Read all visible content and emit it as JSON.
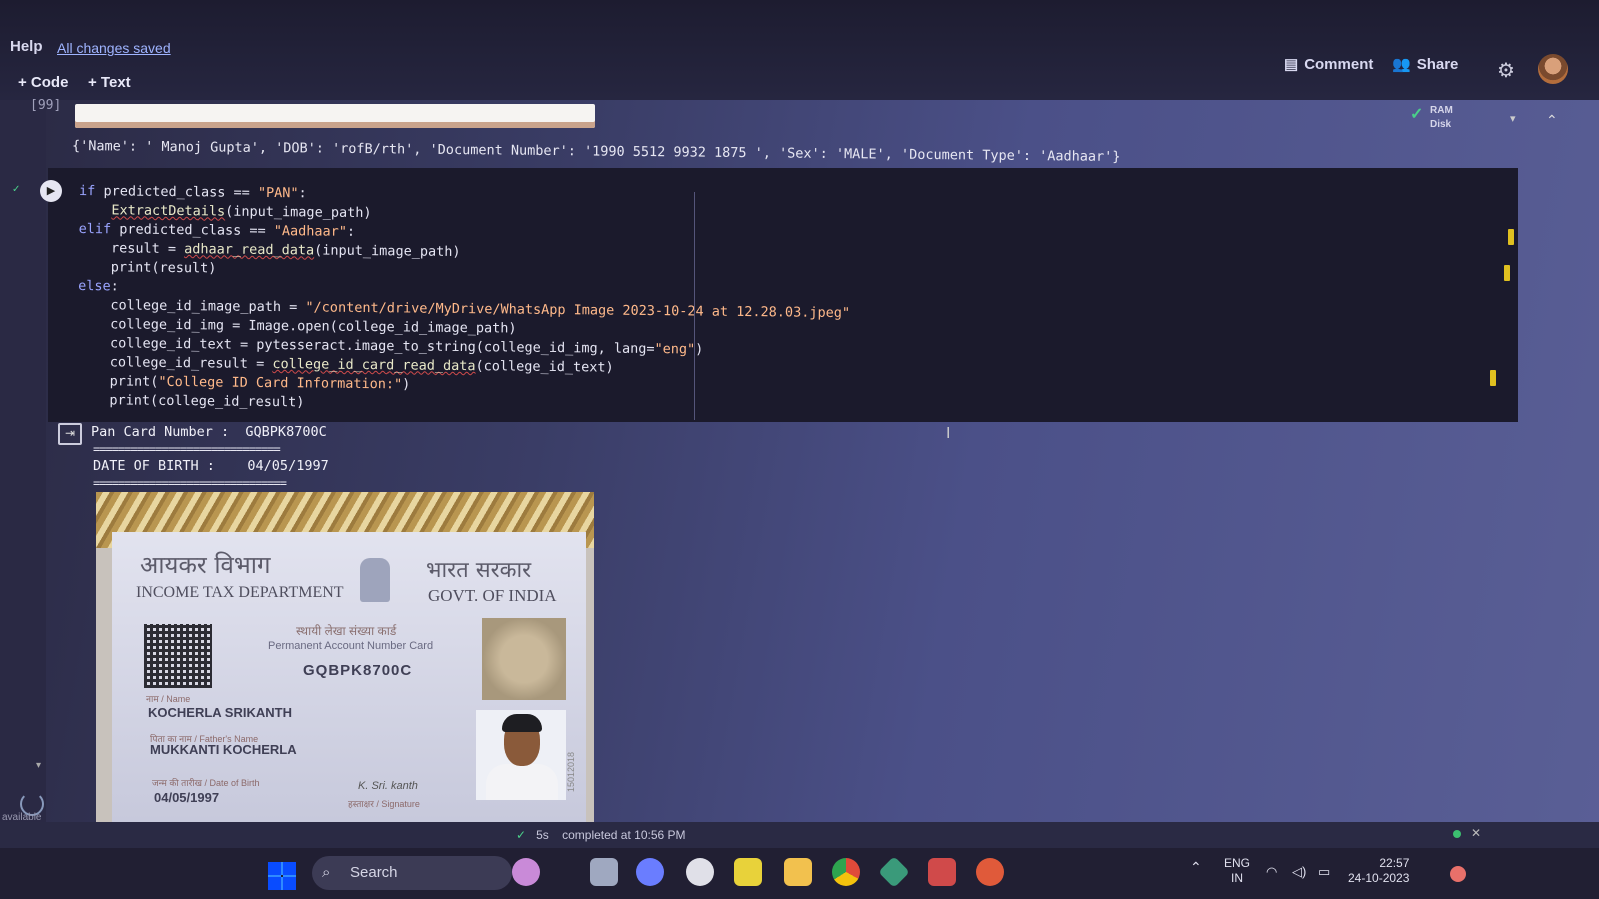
{
  "menu": {
    "help": "Help",
    "saved": "All changes saved"
  },
  "toolbar": {
    "code": "+ Code",
    "text": "+ Text"
  },
  "actions": {
    "comment": "Comment",
    "share": "Share"
  },
  "resources": {
    "ram": "RAM",
    "disk": "Disk"
  },
  "prev_cell": {
    "exec_count": "[99]",
    "output": "{'Name': ' Manoj Gupta', 'DOB': 'rofB/rth', 'Document Number': '1990 5512 9932 1875 ', 'Sex': 'MALE', 'Document Type': 'Aadhaar'}"
  },
  "code_lines": [
    "if predicted_class == \"PAN\":",
    "    ExtractDetails(input_image_path)",
    "elif predicted_class == \"Aadhaar\":",
    "    result = adhaar_read_data(input_image_path)",
    "    print(result)",
    "else:",
    "    college_id_image_path = \"/content/drive/MyDrive/WhatsApp Image 2023-10-24 at 12.28.03.jpeg\"",
    "    college_id_img = Image.open(college_id_image_path)",
    "    college_id_text = pytesseract.image_to_string(college_id_img, lang=\"eng\")",
    "    college_id_result = college_id_card_read_data(college_id_text)",
    "    print(\"College ID Card Information:\")",
    "    print(college_id_result)"
  ],
  "output": {
    "pan_line": "Pan Card Number :  GQBPK8700C",
    "sep1": "==============================",
    "dob_line": "DATE OF BIRTH :    04/05/1997",
    "sep2": "==============================="
  },
  "pan_card": {
    "dept_hindi": "आयकर विभाग",
    "dept_english": "INCOME TAX DEPARTMENT",
    "govt_hindi": "भारत सरकार",
    "govt_english": "GOVT. OF INDIA",
    "pan_hindi": "स्थायी लेखा संख्या कार्ड",
    "pan_english": "Permanent Account Number Card",
    "pan_number": "GQBPK8700C",
    "name_label": "नाम / Name",
    "name": "KOCHERLA SRIKANTH",
    "father_label": "पिता का नाम / Father's Name",
    "father_name": "MUKKANTI KOCHERLA",
    "dob_label": "जन्म की तारीख / Date of Birth",
    "dob": "04/05/1997",
    "signature": "K. Sri. kanth",
    "signature_label": "हस्ताक्षर / Signature",
    "serial": "15012018"
  },
  "status": {
    "check": "✓",
    "duration": "5s",
    "text": "completed at 10:56 PM"
  },
  "taskbar": {
    "search": "Search",
    "lang1": "ENG",
    "lang2": "IN",
    "time": "22:57",
    "date": "24-10-2023"
  },
  "left_panel": {
    "available": "available"
  }
}
